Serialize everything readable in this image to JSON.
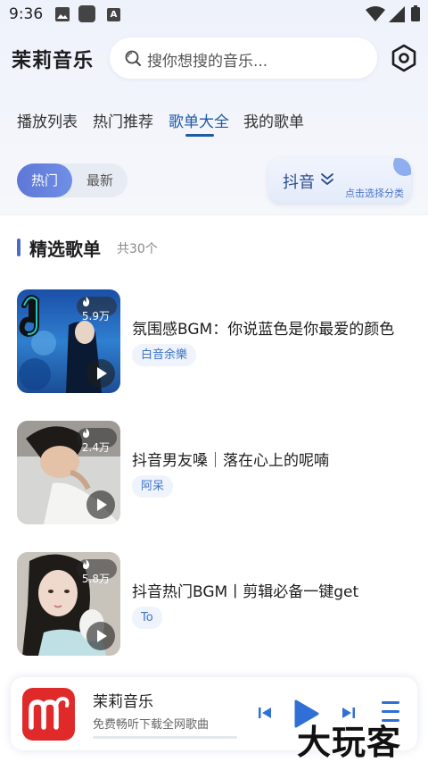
{
  "status_bar": {
    "time": "9:36",
    "notification_letter": "A"
  },
  "header": {
    "app_title": "茉莉音乐",
    "search_placeholder": "搜你想搜的音乐..."
  },
  "tabs": [
    {
      "label": "播放列表",
      "active": false
    },
    {
      "label": "热门推荐",
      "active": false
    },
    {
      "label": "歌单大全",
      "active": true
    },
    {
      "label": "我的歌单",
      "active": false
    }
  ],
  "filters": {
    "segments": [
      {
        "label": "热门",
        "selected": true
      },
      {
        "label": "最新",
        "selected": false
      }
    ],
    "category": {
      "label": "抖音",
      "hint": "点击选择分类"
    }
  },
  "section": {
    "title": "精选歌单",
    "count": "共30个"
  },
  "playlists": [
    {
      "plays": "5.9万",
      "title": "氛围感BGM：你说蓝色是你最爱的颜色",
      "tag": "白音余樂"
    },
    {
      "plays": "2.4万",
      "title": "抖音男友嗓｜落在心上的呢喃",
      "tag": "阿呆"
    },
    {
      "plays": "5.8万",
      "title": "抖音热门BGM丨剪辑必备一键get",
      "tag": "To"
    }
  ],
  "mini_player": {
    "name": "茉莉音乐",
    "subtitle": "免费畅听下载全网歌曲"
  },
  "watermark": "大玩客",
  "colors": {
    "accent": "#1f5aa9",
    "segment_active": "#5e77d6",
    "logo_red": "#e02a2a"
  }
}
